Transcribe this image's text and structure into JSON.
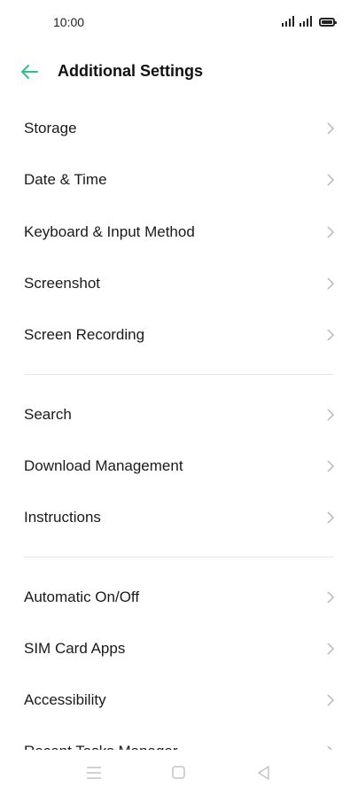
{
  "status_bar": {
    "time": "10:00"
  },
  "header": {
    "title": "Additional Settings",
    "back_icon": "arrow-left-icon",
    "accent_color": "#2fbf8a"
  },
  "groups": [
    {
      "items": [
        {
          "label": "Storage"
        },
        {
          "label": "Date & Time"
        },
        {
          "label": "Keyboard & Input Method"
        },
        {
          "label": "Screenshot"
        },
        {
          "label": "Screen Recording"
        }
      ]
    },
    {
      "items": [
        {
          "label": "Search"
        },
        {
          "label": "Download Management"
        },
        {
          "label": "Instructions"
        }
      ]
    },
    {
      "items": [
        {
          "label": "Automatic On/Off"
        },
        {
          "label": "SIM Card Apps"
        },
        {
          "label": "Accessibility"
        },
        {
          "label": "Recent Tasks Manager"
        }
      ]
    }
  ],
  "nav_bar": {
    "menu_icon": "menu-icon",
    "home_icon": "home-square-icon",
    "back_icon": "back-triangle-icon"
  }
}
